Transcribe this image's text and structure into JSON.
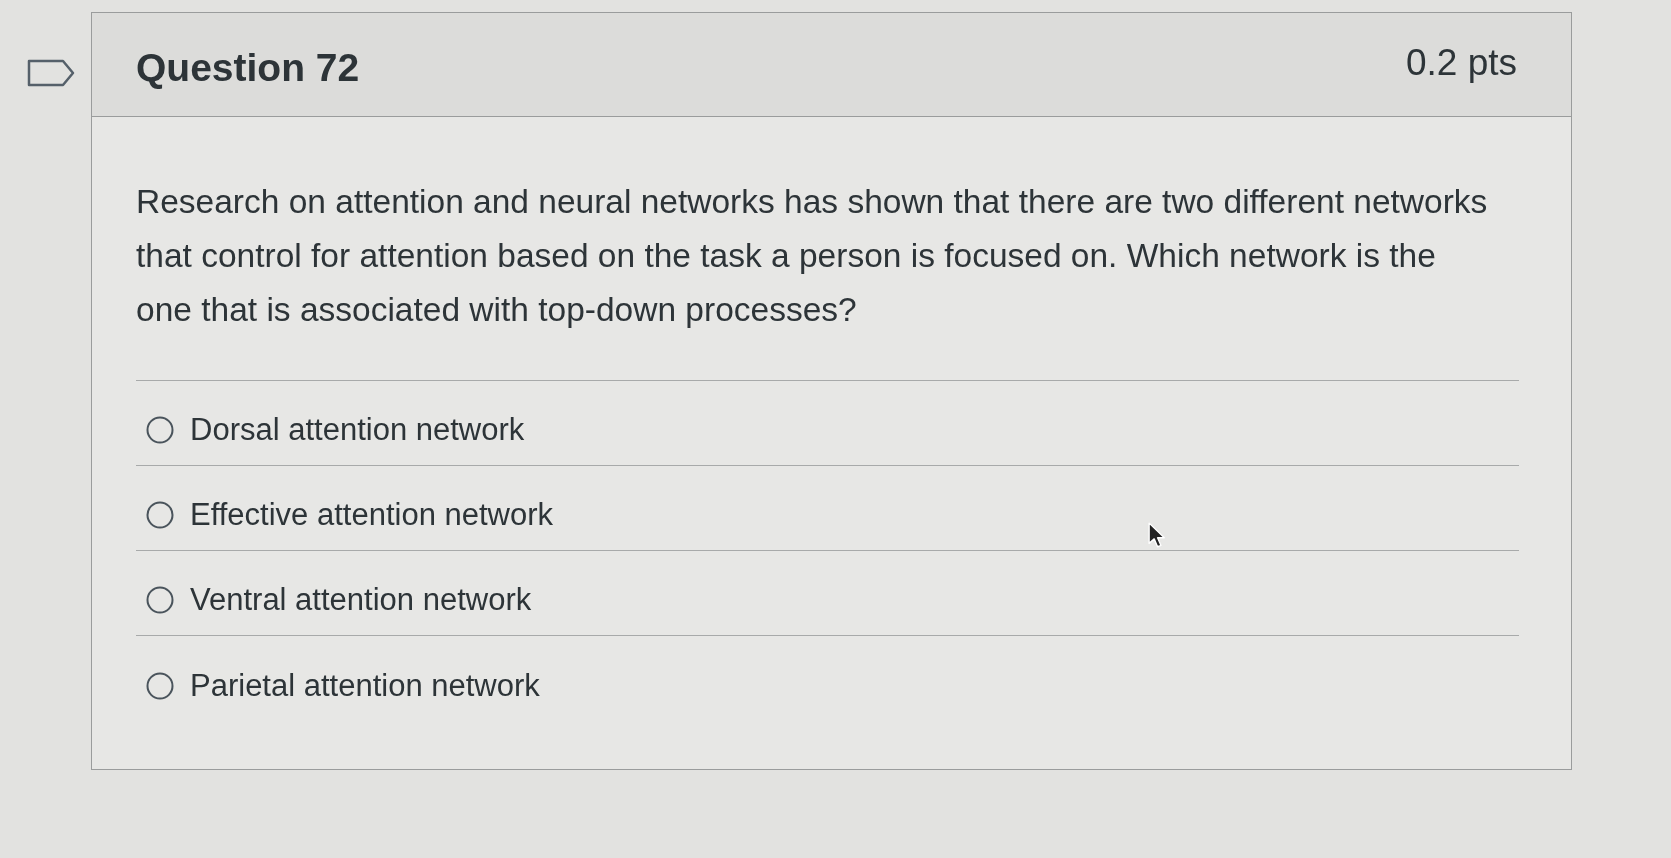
{
  "header": {
    "flagged": false,
    "title": "Question 72",
    "points": "0.2 pts"
  },
  "question": {
    "text": "Research on attention and neural networks has shown that there are two different networks that control for attention based on the task a person is focused on. Which network is the one that is associated with top-down processes?"
  },
  "answers": [
    {
      "label": "Dorsal attention network",
      "selected": false
    },
    {
      "label": "Effective attention network",
      "selected": false
    },
    {
      "label": "Ventral attention network",
      "selected": false
    },
    {
      "label": "Parietal attention network",
      "selected": false
    }
  ]
}
